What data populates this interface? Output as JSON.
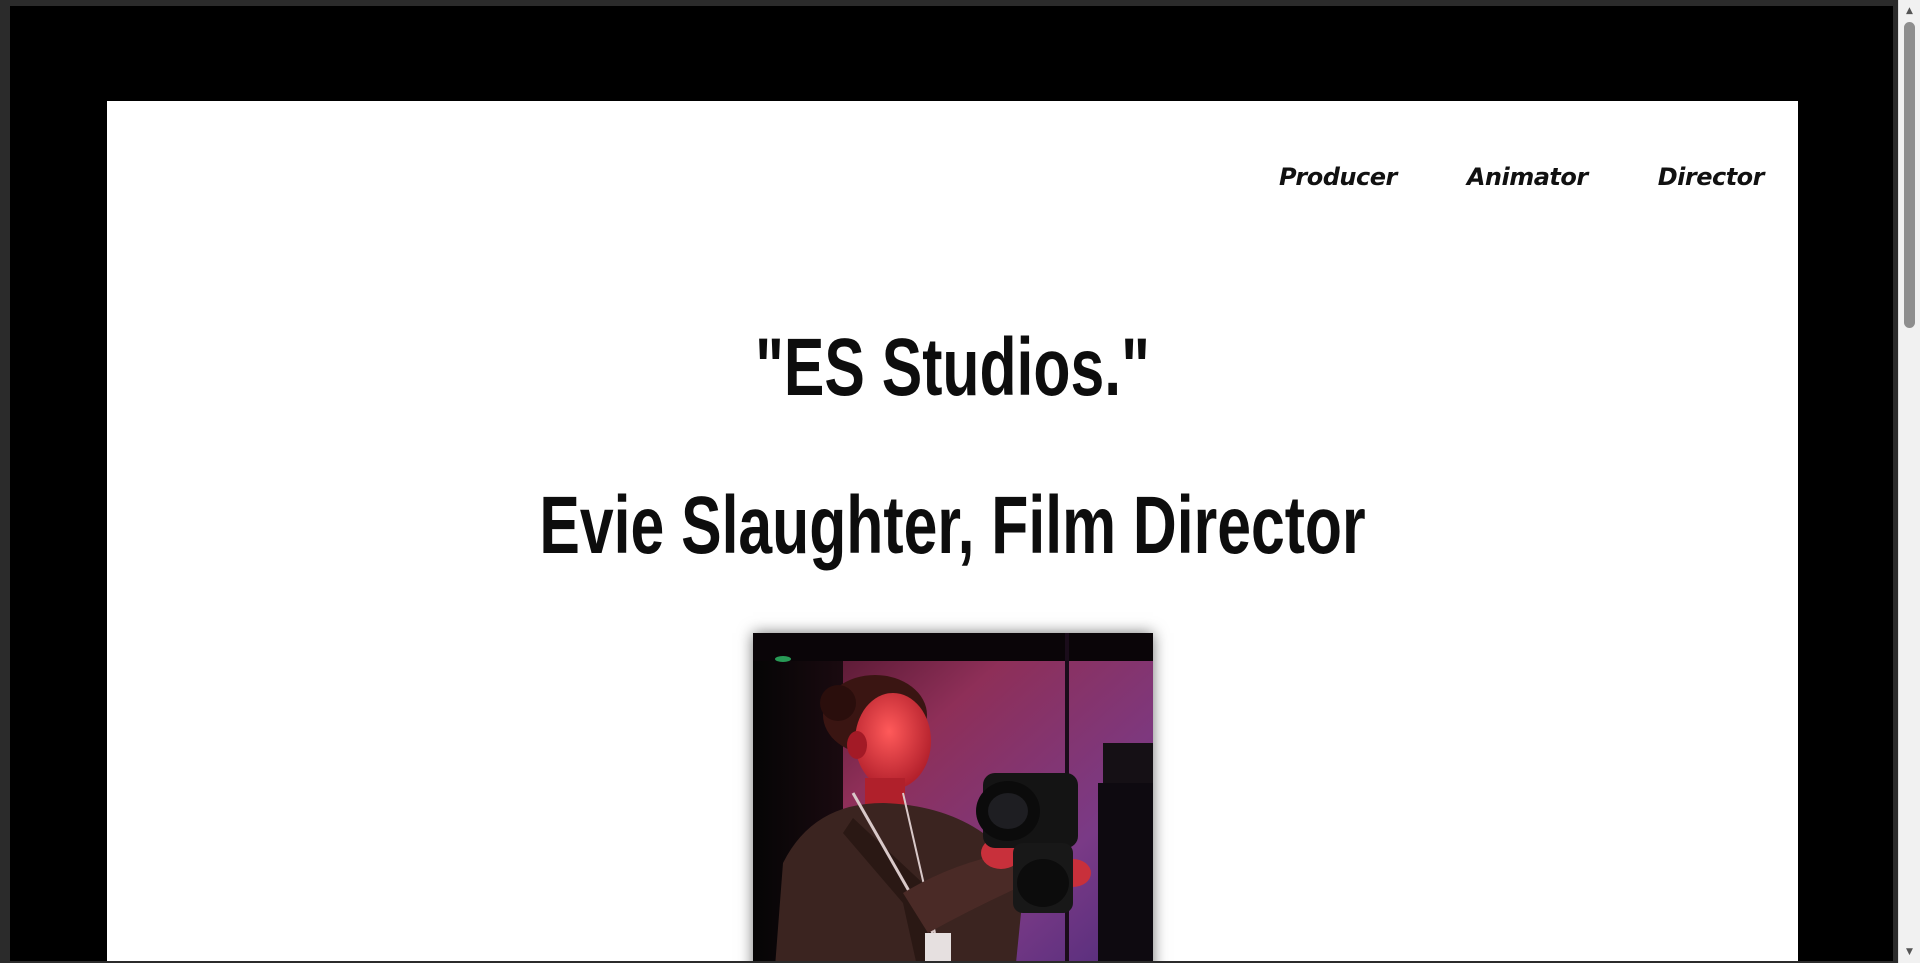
{
  "nav": {
    "items": [
      {
        "label": "Producer"
      },
      {
        "label": "Animator"
      },
      {
        "label": "Director"
      }
    ]
  },
  "hero": {
    "title": "\"ES Studios.\"",
    "subtitle": "Evie Slaughter, Film Director"
  },
  "photo": {
    "alt": "Portrait of a woman holding a camera under red and purple lighting"
  },
  "colors": {
    "frame": "#000000",
    "card": "#ffffff",
    "text": "#0d0d0d"
  }
}
